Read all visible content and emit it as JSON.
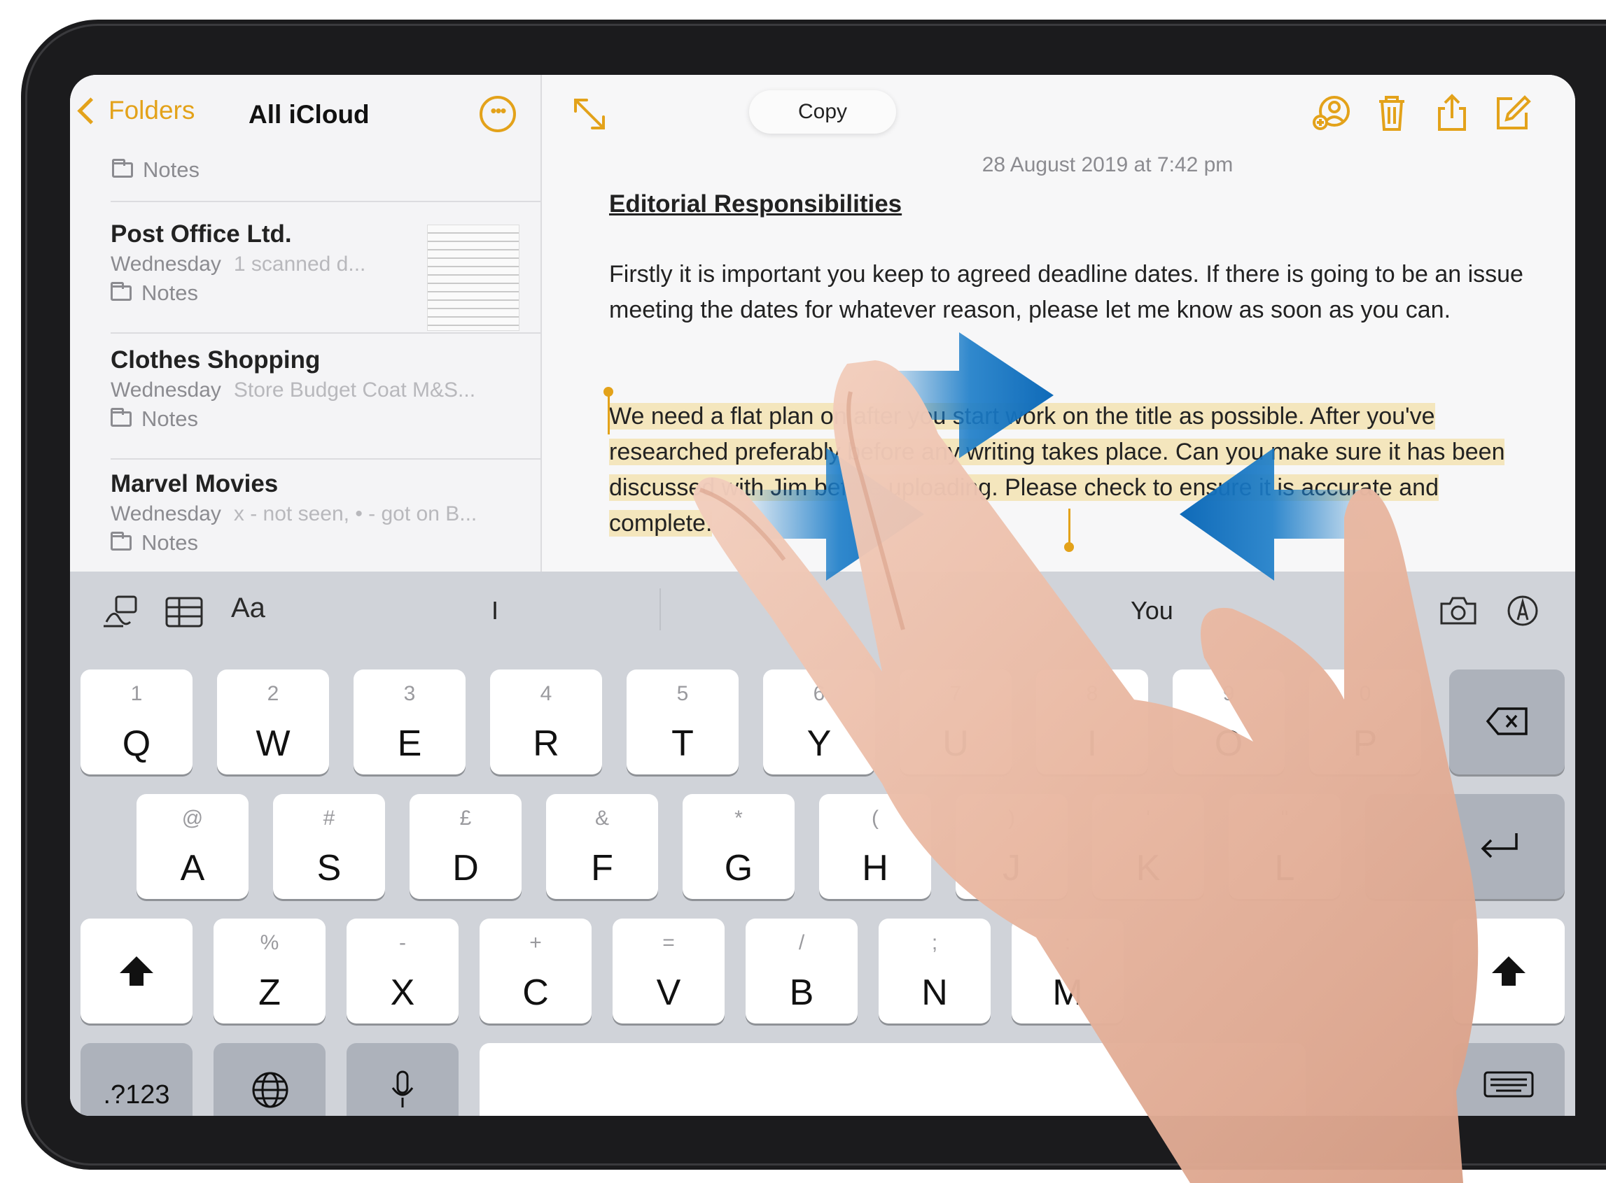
{
  "sidebar": {
    "back_label": "Folders",
    "title": "All iCloud",
    "top_folder": "Notes",
    "notes": [
      {
        "title": "Post Office Ltd.",
        "day": "Wednesday",
        "preview": "1 scanned d...",
        "folder": "Notes"
      },
      {
        "title": "Clothes Shopping",
        "day": "Wednesday",
        "preview": "Store Budget Coat M&S...",
        "folder": "Notes"
      },
      {
        "title": "Marvel Movies",
        "day": "Wednesday",
        "preview": "x - not seen, • - got on B...",
        "folder": "Notes"
      }
    ]
  },
  "editor": {
    "copy_label": "Copy",
    "date": "28 August 2019 at 7:42 pm",
    "heading": "Editorial Responsibilities",
    "para1": "Firstly it is important you keep to agreed deadline dates. If there is going to be an issue meeting the dates for whatever reason, please let me know as soon as you can.",
    "para2": "We need a flat plan on after you start work on the title as possible. After you've researched preferably before any writing takes place. Can you make sure it has been discussed with Jim before uploading. Please check to ensure it is accurate and complete."
  },
  "keyboard": {
    "toolbar": {
      "format_label": "Aa",
      "suggestion_left": "I",
      "suggestion_right": "You"
    },
    "rows": [
      [
        {
          "sub": "1",
          "main": "Q"
        },
        {
          "sub": "2",
          "main": "W"
        },
        {
          "sub": "3",
          "main": "E"
        },
        {
          "sub": "4",
          "main": "R"
        },
        {
          "sub": "5",
          "main": "T"
        },
        {
          "sub": "6",
          "main": "Y"
        },
        {
          "sub": "7",
          "main": "U"
        },
        {
          "sub": "8",
          "main": "I"
        },
        {
          "sub": "9",
          "main": "O"
        },
        {
          "sub": "0",
          "main": "P"
        }
      ],
      [
        {
          "sub": "@",
          "main": "A"
        },
        {
          "sub": "#",
          "main": "S"
        },
        {
          "sub": "£",
          "main": "D"
        },
        {
          "sub": "&",
          "main": "F"
        },
        {
          "sub": "*",
          "main": "G"
        },
        {
          "sub": "(",
          "main": "H"
        },
        {
          "sub": ")",
          "main": "J"
        },
        {
          "sub": "'",
          "main": "K"
        },
        {
          "sub": "\"",
          "main": "L"
        }
      ],
      [
        {
          "sub": "%",
          "main": "Z"
        },
        {
          "sub": "-",
          "main": "X"
        },
        {
          "sub": "+",
          "main": "C"
        },
        {
          "sub": "=",
          "main": "V"
        },
        {
          "sub": "/",
          "main": "B"
        },
        {
          "sub": ";",
          "main": "N"
        },
        {
          "sub": ":",
          "main": "M"
        }
      ]
    ],
    "numbers_label": ".?123"
  }
}
